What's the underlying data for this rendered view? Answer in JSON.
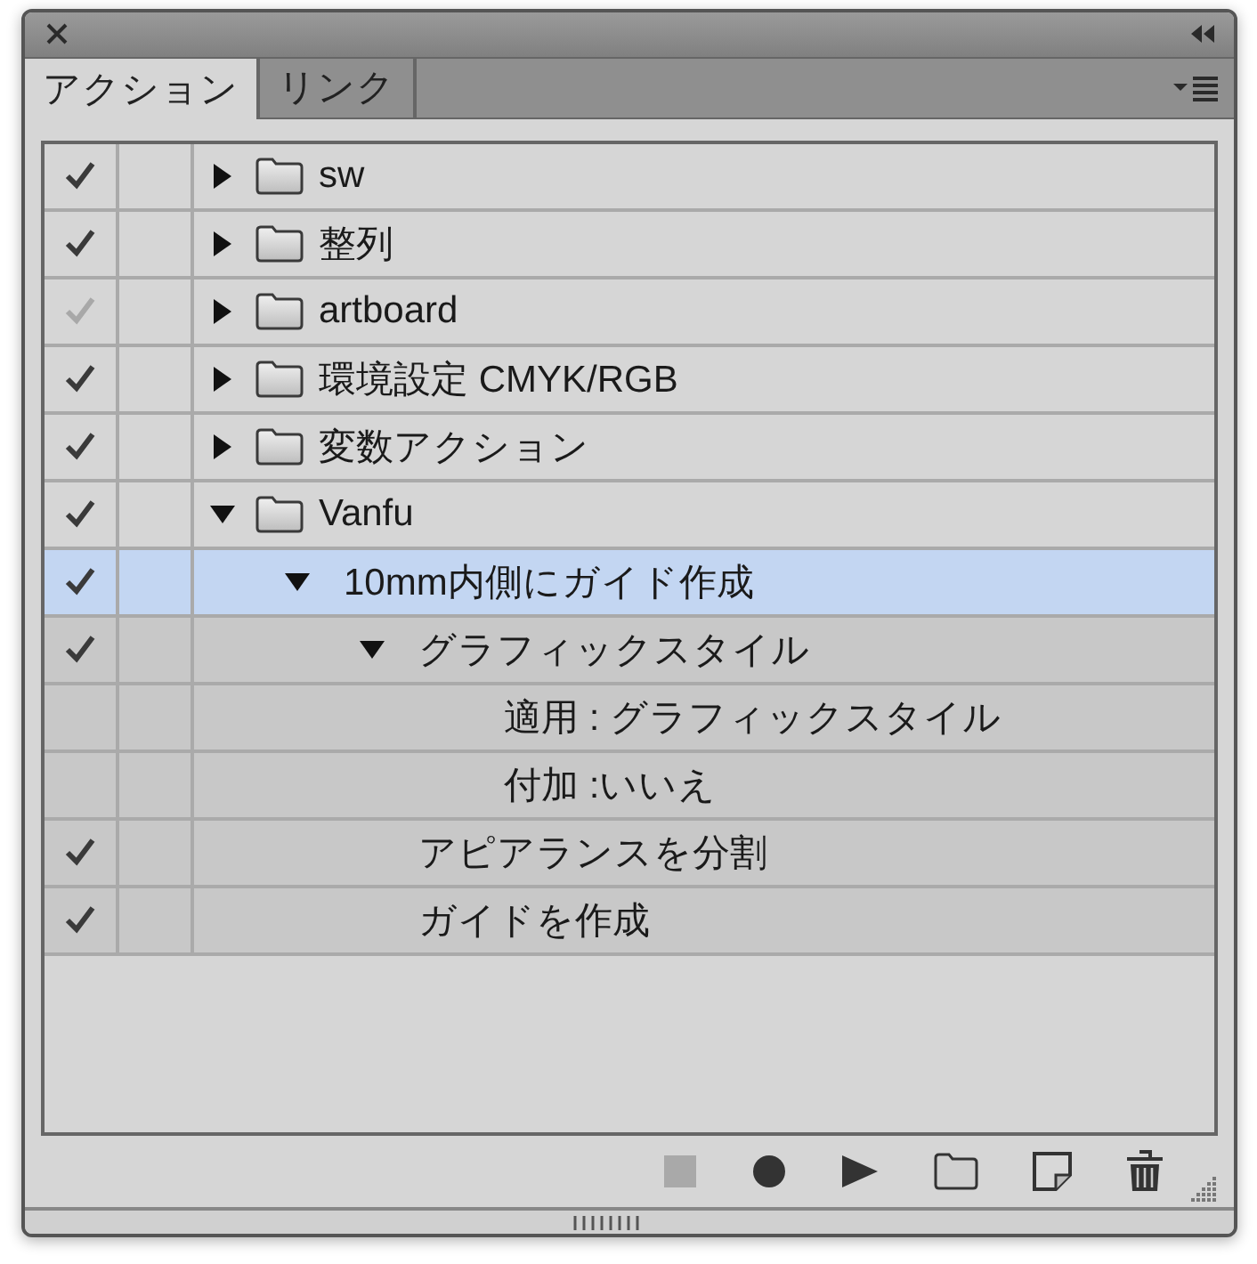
{
  "tabs": [
    {
      "label": "アクション",
      "selected": true
    },
    {
      "label": "リンク",
      "selected": false
    }
  ],
  "actions": [
    {
      "kind": "set",
      "label": "sw",
      "checked": true,
      "dimmed": false,
      "expanded": false,
      "selected": false
    },
    {
      "kind": "set",
      "label": "整列",
      "checked": true,
      "dimmed": false,
      "expanded": false,
      "selected": false
    },
    {
      "kind": "set",
      "label": "artboard",
      "checked": true,
      "dimmed": true,
      "expanded": false,
      "selected": false
    },
    {
      "kind": "set",
      "label": "環境設定 CMYK/RGB",
      "checked": true,
      "dimmed": false,
      "expanded": false,
      "selected": false
    },
    {
      "kind": "set",
      "label": "変数アクション",
      "checked": true,
      "dimmed": false,
      "expanded": false,
      "selected": false
    },
    {
      "kind": "set",
      "label": "Vanfu",
      "checked": true,
      "dimmed": false,
      "expanded": true,
      "selected": false,
      "children": [
        {
          "kind": "action",
          "label": "10mm内側にガイド作成",
          "checked": true,
          "dimmed": false,
          "expanded": true,
          "selected": true,
          "children": [
            {
              "kind": "command",
              "label": "グラフィックスタイル",
              "checked": true,
              "dimmed": false,
              "expanded": true,
              "selected": false,
              "children": [
                {
                  "kind": "parameter",
                  "label": "適用 : グラフィックスタイル",
                  "checked": false,
                  "selected": false
                },
                {
                  "kind": "parameter",
                  "label": "付加 :いいえ",
                  "checked": false,
                  "selected": false
                }
              ]
            },
            {
              "kind": "command",
              "label": "アピアランスを分割",
              "checked": true,
              "dimmed": false,
              "selected": false
            },
            {
              "kind": "command",
              "label": "ガイドを作成",
              "checked": true,
              "dimmed": false,
              "selected": false
            }
          ]
        }
      ]
    }
  ]
}
